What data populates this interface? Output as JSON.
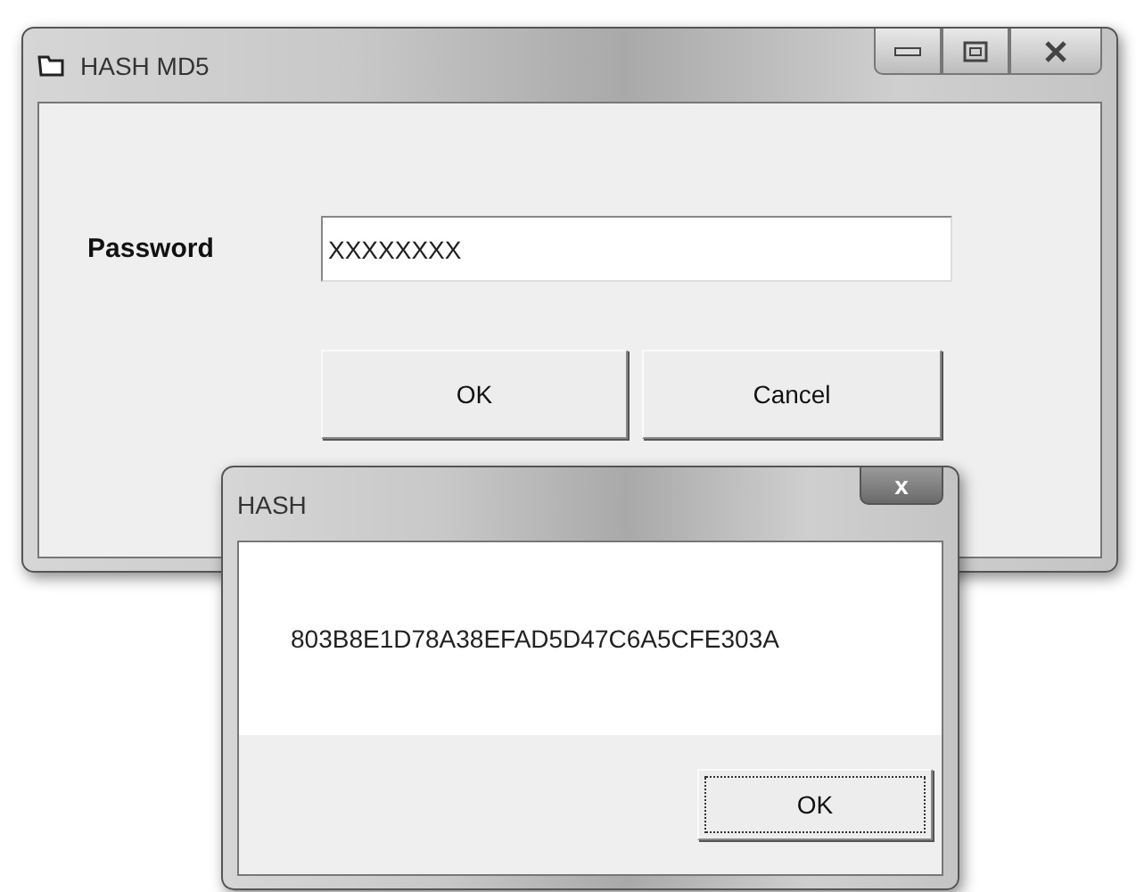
{
  "main_window": {
    "title": "HASH MD5",
    "password_label": "Password",
    "password_value": "XXXXXXXX",
    "buttons": [
      {
        "label": "OK"
      },
      {
        "label": "Cancel"
      }
    ]
  },
  "dialog": {
    "title": "HASH",
    "close_glyph": "x",
    "message": "803B8E1D78A38EFAD5D47C6A5CFE303A",
    "button": {
      "label": "OK",
      "focused": true
    }
  }
}
